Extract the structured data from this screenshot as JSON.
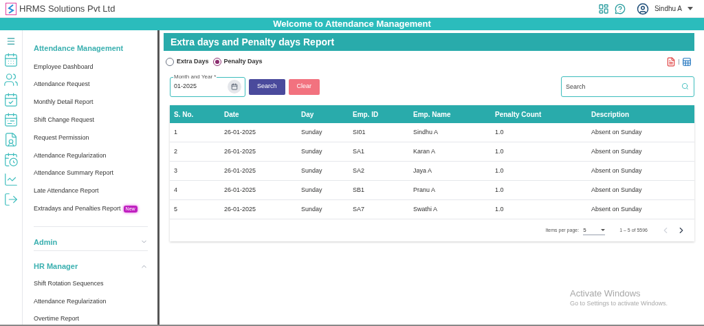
{
  "header": {
    "company": "HRMS Solutions Pvt Ltd",
    "user": "Sindhu A"
  },
  "banner": "Welcome to Attendance Management",
  "sidebar": {
    "sections": [
      {
        "title": "Attendance Management",
        "items": [
          {
            "label": "Employee Dashboard"
          },
          {
            "label": "Attendance Request"
          },
          {
            "label": "Monthly Detail Report"
          },
          {
            "label": "Shift Change Request"
          },
          {
            "label": "Request Permission"
          },
          {
            "label": "Attendance Regularization"
          },
          {
            "label": "Attendance Summary Report"
          },
          {
            "label": "Late Attendance Report"
          },
          {
            "label": "Extradays and Penalties Report",
            "badge": "New"
          }
        ]
      },
      {
        "title": "Admin",
        "expanded": false
      },
      {
        "title": "HR Manager",
        "expanded": true,
        "items": [
          {
            "label": "Shift Rotation Sequences"
          },
          {
            "label": "Attendance Regularization"
          },
          {
            "label": "Overtime Report"
          }
        ]
      }
    ]
  },
  "report": {
    "title": "Extra days and Penalty days Report",
    "options": [
      {
        "label": "Extra Days",
        "selected": false
      },
      {
        "label": "Penalty Days",
        "selected": true
      }
    ],
    "month_field": {
      "label": "Month and Year *",
      "value": "01-2025"
    },
    "buttons": [
      {
        "label": "Search",
        "kind": "primary"
      },
      {
        "label": "Clear",
        "kind": "danger"
      }
    ],
    "search": {
      "placeholder": "Search"
    },
    "table": {
      "columns": [
        "S. No.",
        "Date",
        "Day",
        "Emp. ID",
        "Emp. Name",
        "Penalty Count",
        "Description"
      ],
      "rows": [
        [
          "1",
          "26-01-2025",
          "Sunday",
          "SI01",
          "Sindhu A",
          "1.0",
          "Absent on Sunday"
        ],
        [
          "2",
          "26-01-2025",
          "Sunday",
          "SA1",
          "Karan A",
          "1.0",
          "Absent on Sunday"
        ],
        [
          "3",
          "26-01-2025",
          "Sunday",
          "SA2",
          "Jaya A",
          "1.0",
          "Absent on Sunday"
        ],
        [
          "4",
          "26-01-2025",
          "Sunday",
          "SB1",
          "Pranu A",
          "1.0",
          "Absent on Sunday"
        ],
        [
          "5",
          "26-01-2025",
          "Sunday",
          "SA7",
          "Swathi A",
          "1.0",
          "Absent on Sunday"
        ]
      ]
    },
    "paginator": {
      "label": "Items per page:",
      "page_size": "5",
      "range": "1 – 5 of 5596",
      "prev_disabled": true,
      "next_disabled": false
    }
  },
  "windows_notice": {
    "title": "Activate Windows",
    "text": "Go to Settings to activate Windows."
  }
}
